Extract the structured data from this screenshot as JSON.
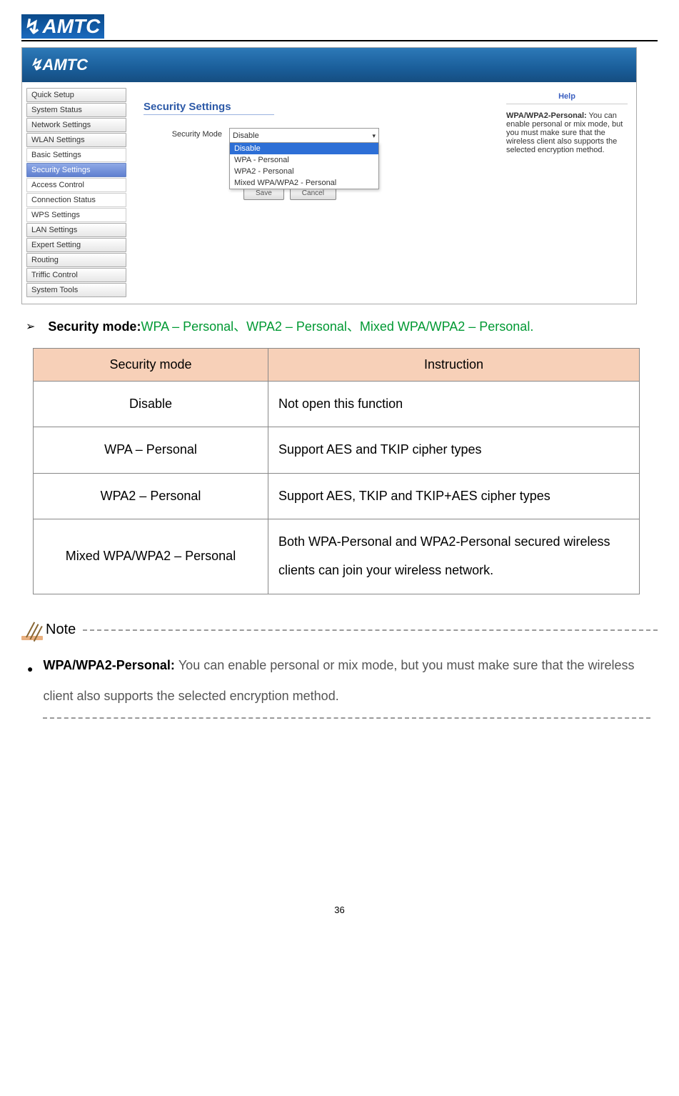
{
  "header": {
    "logo_text": "AMTC"
  },
  "screenshot": {
    "banner_logo": "AMTC",
    "sidebar": [
      {
        "label": "Quick Setup",
        "type": "top"
      },
      {
        "label": "System Status",
        "type": "top"
      },
      {
        "label": "Network Settings",
        "type": "top"
      },
      {
        "label": "WLAN Settings",
        "type": "top"
      },
      {
        "label": "Basic Settings",
        "type": "sub"
      },
      {
        "label": "Security Settings",
        "type": "active"
      },
      {
        "label": "Access Control",
        "type": "sub"
      },
      {
        "label": "Connection Status",
        "type": "sub"
      },
      {
        "label": "WPS Settings",
        "type": "sub"
      },
      {
        "label": "LAN Settings",
        "type": "top"
      },
      {
        "label": "Expert Setting",
        "type": "top"
      },
      {
        "label": "Routing",
        "type": "top"
      },
      {
        "label": "Triffic Control",
        "type": "top"
      },
      {
        "label": "System Tools",
        "type": "top"
      }
    ],
    "main": {
      "title": "Security Settings",
      "form_label": "Security Mode",
      "selected": "Disable",
      "options": [
        "Disable",
        "WPA - Personal",
        "WPA2 - Personal",
        "Mixed WPA/WPA2 - Personal"
      ],
      "save": "Save",
      "cancel": "Cancel"
    },
    "help": {
      "title": "Help",
      "bold": "WPA/WPA2-Personal:",
      "text": " You can enable personal or mix mode, but you must make sure that the wireless client also supports the selected encryption method."
    }
  },
  "bullet": {
    "label": "Security mode:",
    "modes": "WPA – Personal、WPA2 – Personal、Mixed WPA/WPA2 – Personal."
  },
  "table": {
    "head1": "Security mode",
    "head2": "Instruction",
    "rows": [
      {
        "mode": "Disable",
        "desc": "Not open this function"
      },
      {
        "mode": "WPA – Personal",
        "desc": "Support AES and TKIP cipher types"
      },
      {
        "mode": "WPA2 – Personal",
        "desc": "Support AES, TKIP and TKIP+AES cipher types"
      },
      {
        "mode": "Mixed WPA/WPA2 – Personal",
        "desc": "Both WPA-Personal and WPA2-Personal secured wireless clients can join your wireless network."
      }
    ]
  },
  "note": {
    "title": "Note",
    "bold": "WPA/WPA2-Personal: ",
    "text": "You can enable personal or mix mode, but you must make sure that the wireless client also supports the selected encryption method."
  },
  "page_number": "36"
}
